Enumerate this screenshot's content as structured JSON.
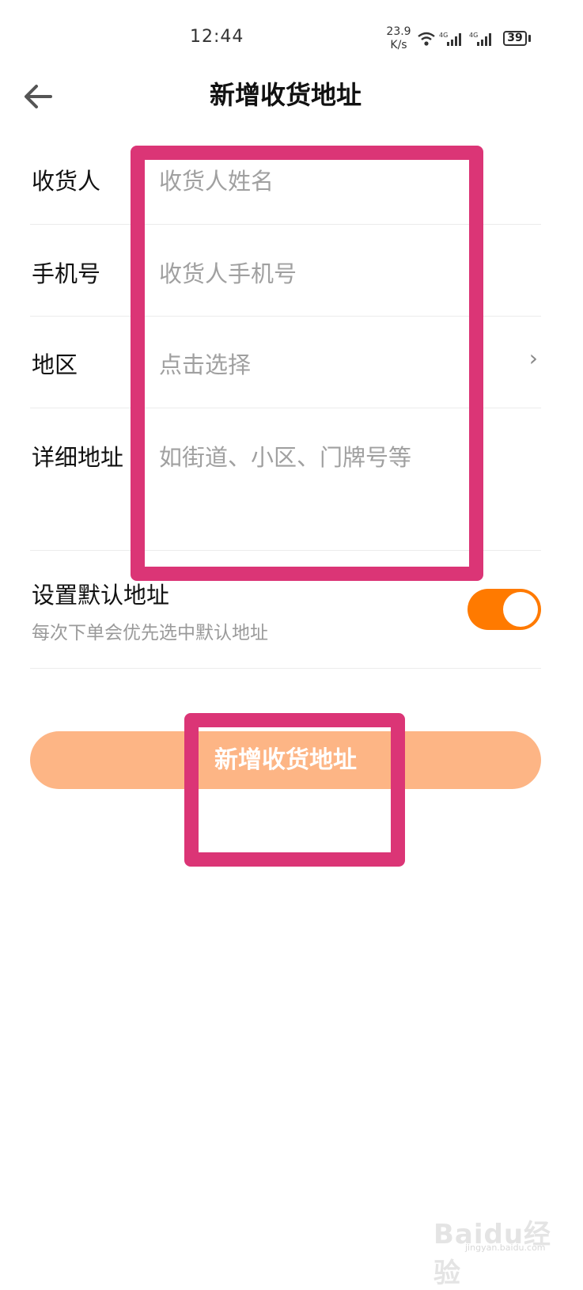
{
  "status_bar": {
    "time": "12:44",
    "net_speed_value": "23.9",
    "net_speed_unit": "K/s",
    "signal_label_1": "4G",
    "signal_label_2": "4G",
    "battery": "39"
  },
  "header": {
    "back_icon": "arrow-left-icon",
    "title": "新增收货地址"
  },
  "form": {
    "recipient": {
      "label": "收货人",
      "placeholder": "收货人姓名"
    },
    "phone": {
      "label": "手机号",
      "placeholder": "收货人手机号"
    },
    "region": {
      "label": "地区",
      "placeholder": "点击选择",
      "chevron": "›"
    },
    "detail": {
      "label": "详细地址",
      "placeholder": "如街道、小区、门牌号等"
    }
  },
  "default_address": {
    "title": "设置默认地址",
    "subtitle": "每次下单会优先选中默认地址",
    "enabled": true
  },
  "submit": {
    "label": "新增收货地址"
  },
  "watermark": {
    "text": "Baidu经验",
    "sub": "jingyan.baidu.com"
  },
  "colors": {
    "accent": "#ff7a00",
    "button_bg": "#fdb585",
    "annotation": "#db3576",
    "placeholder": "#a0a0a0"
  }
}
